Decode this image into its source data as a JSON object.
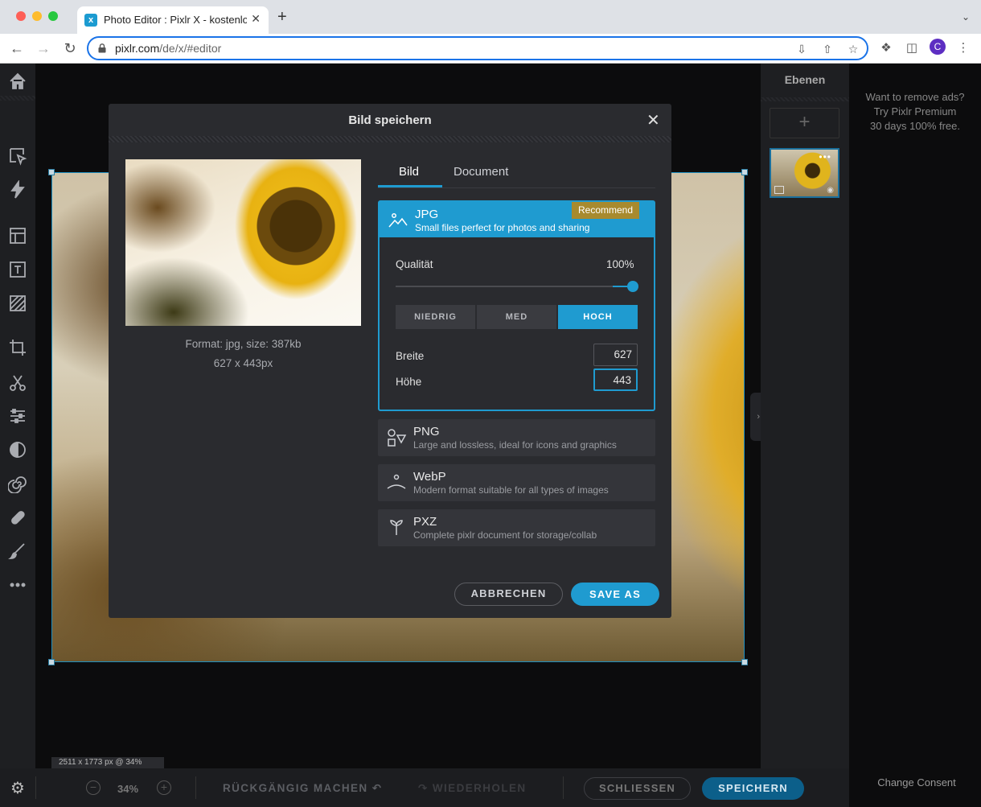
{
  "browser": {
    "tab_title": "Photo Editor : Pixlr X - kostenlo",
    "tab_close": "✕",
    "new_tab": "+",
    "url_host": "pixlr.com",
    "url_path": "/de/x/#editor",
    "avatar_letter": "C"
  },
  "toolbar": {
    "tools": [
      "home-icon",
      "arrange-icon",
      "quick-action-icon",
      "layout-icon",
      "text-icon",
      "pattern-icon",
      "crop-icon",
      "cutout-icon",
      "adjust-icon",
      "filter-icon",
      "liquify-icon",
      "retouch-icon",
      "draw-icon",
      "more-icon"
    ]
  },
  "canvas": {
    "status": "2511 x 1773 px @ 34%"
  },
  "layers": {
    "title": "Ebenen",
    "add": "+",
    "more": "•••"
  },
  "ad": {
    "lines": [
      "Want to remove ads?",
      "Try Pixlr Premium",
      "30 days 100% free."
    ],
    "consent": "Change Consent"
  },
  "bottom": {
    "zoom": "34%",
    "undo": "RÜCKGÄNGIG MACHEN",
    "redo": "WIEDERHOLEN",
    "close": "SCHLIESSEN",
    "save": "SPEICHERN"
  },
  "dialog": {
    "title": "Bild speichern",
    "close": "✕",
    "format_info": "Format: jpg, size: 387kb",
    "dimensions_info": "627 x 443px",
    "tabs": [
      {
        "label": "Bild",
        "active": true
      },
      {
        "label": "Document",
        "active": false
      }
    ],
    "jpg": {
      "name": "JPG",
      "desc": "Small files perfect for photos and sharing",
      "badge": "Recommend",
      "quality_label": "Qualität",
      "quality_value": "100%",
      "quality_fraction": 1.0,
      "presets": [
        {
          "label": "NIEDRIG",
          "active": false
        },
        {
          "label": "MED",
          "active": false
        },
        {
          "label": "HOCH",
          "active": true
        }
      ],
      "width_label": "Breite",
      "width_value": "627",
      "height_label": "Höhe",
      "height_value": "443"
    },
    "formats": [
      {
        "name": "PNG",
        "desc": "Large and lossless, ideal for icons and graphics",
        "icon": "shapes-icon"
      },
      {
        "name": "WebP",
        "desc": "Modern format suitable for all types of images",
        "icon": "webp-icon"
      },
      {
        "name": "PXZ",
        "desc": "Complete pixlr document for storage/collab",
        "icon": "pxz-icon"
      }
    ],
    "cancel": "ABBRECHEN",
    "save_as": "SAVE AS"
  },
  "colors": {
    "accent": "#1f9bd0",
    "badge": "#a88a2e",
    "dialog_bg": "#2a2b2f"
  }
}
